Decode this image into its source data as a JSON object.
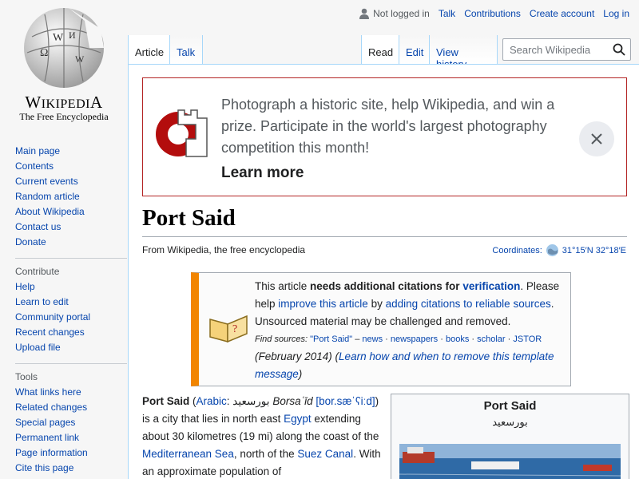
{
  "logo": {
    "wordmark": "Wikipedia",
    "tagline": "The Free Encyclopedia"
  },
  "personal_tools": {
    "status": "Not logged in",
    "links": [
      "Talk",
      "Contributions",
      "Create account",
      "Log in"
    ]
  },
  "sidebar": {
    "navigation": [
      "Main page",
      "Contents",
      "Current events",
      "Random article",
      "About Wikipedia",
      "Contact us",
      "Donate"
    ],
    "contribute_heading": "Contribute",
    "contribute": [
      "Help",
      "Learn to edit",
      "Community portal",
      "Recent changes",
      "Upload file"
    ],
    "tools_heading": "Tools",
    "tools": [
      "What links here",
      "Related changes",
      "Special pages",
      "Permanent link",
      "Page information",
      "Cite this page"
    ]
  },
  "tabs": {
    "left": [
      "Article",
      "Talk"
    ],
    "right": [
      "Read",
      "Edit",
      "View history"
    ]
  },
  "search": {
    "placeholder": "Search Wikipedia"
  },
  "banner": {
    "message": "Photograph a historic site, help Wikipedia, and win a prize. Participate in the world's largest photography competition this month!",
    "learn_more": "Learn more"
  },
  "article": {
    "title": "Port Said",
    "tagline": "From Wikipedia, the free encyclopedia",
    "coordinates_label": "Coordinates:",
    "coordinates_value": "31°15′N 32°18′E"
  },
  "ambox": {
    "line1_pre": "This article ",
    "line1_bold": "needs additional citations for ",
    "line1_link": "verification",
    "line1_post": ". Please help ",
    "improve_link": "improve this article",
    "by": " by ",
    "adding_link": "adding citations to reliable sources",
    "unsourced": ". Unsourced material may be challenged and removed.",
    "find_sources_label": "Find sources:",
    "find_sources_links": [
      "\"Port Said\"",
      "news",
      "newspapers",
      "books",
      "scholar",
      "JSTOR"
    ],
    "date": "(February 2014)",
    "learn_remove": "Learn how and when to remove this template message"
  },
  "paragraph": {
    "bold": "Port Said",
    "arabic_link": "Arabic",
    "arabic_script": "بورسعيد",
    "translit": "Borsaʿīd",
    "ipa": "[bor.sæˈʕiːd]",
    "text1": " is a city that lies in north east ",
    "egypt": "Egypt",
    "text2": " extending about 30 kilometres (19 mi) along the coast of the ",
    "med": "Mediterranean Sea",
    "text3": ", north of the ",
    "suez": "Suez Canal",
    "text4": ". With an approximate population of"
  },
  "infobox": {
    "name": "Port Said",
    "native": "بورسعيد"
  },
  "colors": {
    "link": "#0645ad",
    "banner_border": "#b32424",
    "ambox_stripe": "#f28500"
  }
}
